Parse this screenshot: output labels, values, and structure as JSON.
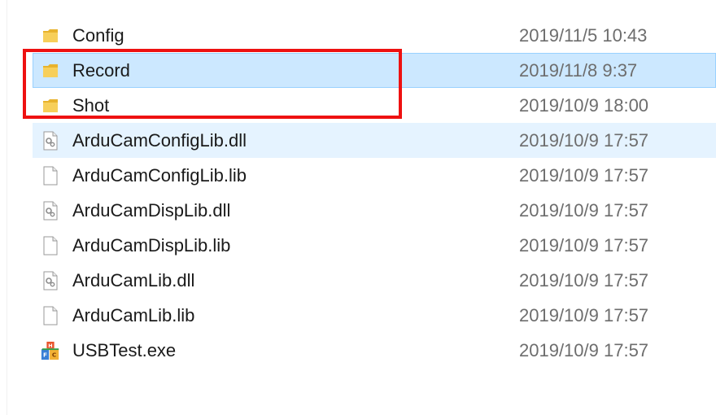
{
  "files": [
    {
      "name": "Config",
      "date": "2019/11/5 10:43",
      "icon": "folder-icon"
    },
    {
      "name": "Record",
      "date": "2019/11/8 9:37",
      "icon": "folder-icon"
    },
    {
      "name": "Shot",
      "date": "2019/10/9 18:00",
      "icon": "folder-icon"
    },
    {
      "name": "ArduCamConfigLib.dll",
      "date": "2019/10/9 17:57",
      "icon": "dll-file-icon"
    },
    {
      "name": "ArduCamConfigLib.lib",
      "date": "2019/10/9 17:57",
      "icon": "blank-file-icon"
    },
    {
      "name": "ArduCamDispLib.dll",
      "date": "2019/10/9 17:57",
      "icon": "dll-file-icon"
    },
    {
      "name": "ArduCamDispLib.lib",
      "date": "2019/10/9 17:57",
      "icon": "blank-file-icon"
    },
    {
      "name": "ArduCamLib.dll",
      "date": "2019/10/9 17:57",
      "icon": "dll-file-icon"
    },
    {
      "name": "ArduCamLib.lib",
      "date": "2019/10/9 17:57",
      "icon": "blank-file-icon"
    },
    {
      "name": "USBTest.exe",
      "date": "2019/10/9 17:57",
      "icon": "exe-app-icon"
    }
  ],
  "colors": {
    "selection_bg": "#cce8ff",
    "hover_bg": "#e5f3ff",
    "highlight_border": "#ee1111",
    "folder": "#f3c244"
  }
}
